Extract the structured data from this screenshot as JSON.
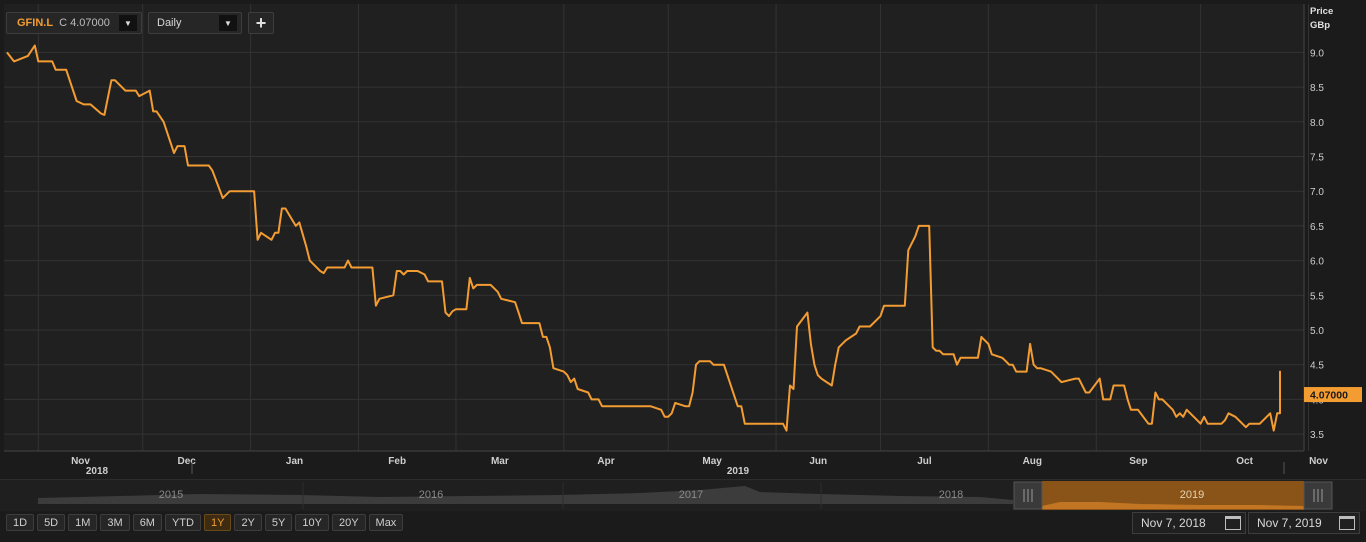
{
  "toolbar": {
    "symbol": "GFIN.L",
    "close_label": "C 4.07000",
    "interval": "Daily",
    "add_label": "+"
  },
  "colors": {
    "series": "#f39c32",
    "background": "#1b1b1b",
    "grid": "#333333"
  },
  "icons": {
    "dropdown": "triangle-down-icon",
    "calendar": "calendar-icon",
    "add": "plus-icon",
    "handle": "grip-icon"
  },
  "navigator": {
    "years": [
      "2015",
      "2016",
      "2017",
      "2018",
      "2019"
    ],
    "selected_year": "2019"
  },
  "range_buttons": [
    "1D",
    "5D",
    "1M",
    "3M",
    "6M",
    "YTD",
    "1Y",
    "2Y",
    "5Y",
    "10Y",
    "20Y",
    "Max"
  ],
  "active_range": "1Y",
  "date_range": {
    "start": "Nov 7, 2018",
    "end": "Nov 7, 2019"
  },
  "chart_data": {
    "type": "line",
    "title": "",
    "ylabel_line1": "Price",
    "ylabel_line2": "GBp",
    "ylim": [
      3.2,
      9.5
    ],
    "yticks": [
      "9.0",
      "8.5",
      "8.0",
      "7.5",
      "7.0",
      "6.5",
      "6.0",
      "5.5",
      "5.0",
      "4.5",
      "4.0",
      "3.5"
    ],
    "last_value_label": "4.07000",
    "last_value": 4.07,
    "months": [
      "Nov",
      "Dec",
      "Jan",
      "Feb",
      "Mar",
      "Apr",
      "May",
      "Jun",
      "Jul",
      "Aug",
      "Sep",
      "Oct",
      "Nov"
    ],
    "years": [
      "2018",
      "2019"
    ],
    "x_start": "2018-11-07",
    "x_end": "2019-11-07",
    "series": [
      {
        "values": [
          [
            "2018-10-23",
            9.0
          ],
          [
            "2018-10-25",
            8.87
          ],
          [
            "2018-10-29",
            8.95
          ],
          [
            "2018-10-31",
            9.1
          ],
          [
            "2018-11-01",
            8.87
          ],
          [
            "2018-11-05",
            8.87
          ],
          [
            "2018-11-06",
            8.75
          ],
          [
            "2018-11-09",
            8.75
          ],
          [
            "2018-11-12",
            8.3
          ],
          [
            "2018-11-14",
            8.25
          ],
          [
            "2018-11-16",
            8.25
          ],
          [
            "2018-11-19",
            8.12
          ],
          [
            "2018-11-20",
            8.1
          ],
          [
            "2018-11-22",
            8.6
          ],
          [
            "2018-11-23",
            8.6
          ],
          [
            "2018-11-26",
            8.45
          ],
          [
            "2018-11-29",
            8.45
          ],
          [
            "2018-11-30",
            8.37
          ],
          [
            "2018-12-03",
            8.45
          ],
          [
            "2018-12-04",
            8.15
          ],
          [
            "2018-12-05",
            8.15
          ],
          [
            "2018-12-07",
            8.0
          ],
          [
            "2018-12-10",
            7.55
          ],
          [
            "2018-12-11",
            7.65
          ],
          [
            "2018-12-13",
            7.65
          ],
          [
            "2018-12-14",
            7.37
          ],
          [
            "2018-12-20",
            7.37
          ],
          [
            "2018-12-21",
            7.3
          ],
          [
            "2018-12-24",
            6.9
          ],
          [
            "2018-12-26",
            7.0
          ],
          [
            "2019-01-02",
            7.0
          ],
          [
            "2019-01-03",
            6.3
          ],
          [
            "2019-01-04",
            6.4
          ],
          [
            "2019-01-07",
            6.3
          ],
          [
            "2019-01-08",
            6.4
          ],
          [
            "2019-01-09",
            6.4
          ],
          [
            "2019-01-10",
            6.75
          ],
          [
            "2019-01-11",
            6.75
          ],
          [
            "2019-01-14",
            6.5
          ],
          [
            "2019-01-15",
            6.55
          ],
          [
            "2019-01-17",
            6.2
          ],
          [
            "2019-01-18",
            6.0
          ],
          [
            "2019-01-21",
            5.85
          ],
          [
            "2019-01-22",
            5.82
          ],
          [
            "2019-01-23",
            5.9
          ],
          [
            "2019-01-28",
            5.9
          ],
          [
            "2019-01-29",
            6.0
          ],
          [
            "2019-01-30",
            5.9
          ],
          [
            "2019-02-05",
            5.9
          ],
          [
            "2019-02-06",
            5.35
          ],
          [
            "2019-02-07",
            5.45
          ],
          [
            "2019-02-11",
            5.5
          ],
          [
            "2019-02-12",
            5.85
          ],
          [
            "2019-02-13",
            5.85
          ],
          [
            "2019-02-14",
            5.8
          ],
          [
            "2019-02-15",
            5.85
          ],
          [
            "2019-02-18",
            5.85
          ],
          [
            "2019-02-20",
            5.8
          ],
          [
            "2019-02-21",
            5.7
          ],
          [
            "2019-02-25",
            5.7
          ],
          [
            "2019-02-26",
            5.25
          ],
          [
            "2019-02-27",
            5.2
          ],
          [
            "2019-02-28",
            5.27
          ],
          [
            "2019-03-01",
            5.3
          ],
          [
            "2019-03-04",
            5.3
          ],
          [
            "2019-03-05",
            5.75
          ],
          [
            "2019-03-06",
            5.6
          ],
          [
            "2019-03-07",
            5.65
          ],
          [
            "2019-03-11",
            5.65
          ],
          [
            "2019-03-13",
            5.55
          ],
          [
            "2019-03-14",
            5.45
          ],
          [
            "2019-03-18",
            5.4
          ],
          [
            "2019-03-19",
            5.25
          ],
          [
            "2019-03-20",
            5.1
          ],
          [
            "2019-03-25",
            5.1
          ],
          [
            "2019-03-26",
            4.9
          ],
          [
            "2019-03-27",
            4.9
          ],
          [
            "2019-03-28",
            4.75
          ],
          [
            "2019-03-29",
            4.45
          ],
          [
            "2019-04-01",
            4.4
          ],
          [
            "2019-04-02",
            4.35
          ],
          [
            "2019-04-03",
            4.25
          ],
          [
            "2019-04-04",
            4.3
          ],
          [
            "2019-04-05",
            4.15
          ],
          [
            "2019-04-08",
            4.1
          ],
          [
            "2019-04-09",
            4.0
          ],
          [
            "2019-04-11",
            4.0
          ],
          [
            "2019-04-12",
            3.9
          ],
          [
            "2019-04-26",
            3.9
          ],
          [
            "2019-04-29",
            3.85
          ],
          [
            "2019-04-30",
            3.75
          ],
          [
            "2019-05-01",
            3.75
          ],
          [
            "2019-05-02",
            3.8
          ],
          [
            "2019-05-03",
            3.95
          ],
          [
            "2019-05-06",
            3.9
          ],
          [
            "2019-05-07",
            3.9
          ],
          [
            "2019-05-08",
            4.1
          ],
          [
            "2019-05-09",
            4.5
          ],
          [
            "2019-05-10",
            4.55
          ],
          [
            "2019-05-13",
            4.55
          ],
          [
            "2019-05-14",
            4.5
          ],
          [
            "2019-05-17",
            4.5
          ],
          [
            "2019-05-20",
            4.05
          ],
          [
            "2019-05-21",
            3.9
          ],
          [
            "2019-05-22",
            3.9
          ],
          [
            "2019-05-23",
            3.65
          ],
          [
            "2019-06-03",
            3.65
          ],
          [
            "2019-06-04",
            3.55
          ],
          [
            "2019-06-05",
            4.2
          ],
          [
            "2019-06-06",
            4.15
          ],
          [
            "2019-06-07",
            5.05
          ],
          [
            "2019-06-10",
            5.25
          ],
          [
            "2019-06-11",
            4.8
          ],
          [
            "2019-06-12",
            4.5
          ],
          [
            "2019-06-13",
            4.35
          ],
          [
            "2019-06-14",
            4.3
          ],
          [
            "2019-06-17",
            4.2
          ],
          [
            "2019-06-18",
            4.5
          ],
          [
            "2019-06-19",
            4.75
          ],
          [
            "2019-06-20",
            4.8
          ],
          [
            "2019-06-21",
            4.85
          ],
          [
            "2019-06-24",
            4.95
          ],
          [
            "2019-06-25",
            5.05
          ],
          [
            "2019-06-28",
            5.05
          ],
          [
            "2019-07-01",
            5.2
          ],
          [
            "2019-07-02",
            5.35
          ],
          [
            "2019-07-08",
            5.35
          ],
          [
            "2019-07-09",
            6.15
          ],
          [
            "2019-07-11",
            6.35
          ],
          [
            "2019-07-12",
            6.5
          ],
          [
            "2019-07-15",
            6.5
          ],
          [
            "2019-07-16",
            4.75
          ],
          [
            "2019-07-17",
            4.7
          ],
          [
            "2019-07-18",
            4.7
          ],
          [
            "2019-07-19",
            4.65
          ],
          [
            "2019-07-22",
            4.65
          ],
          [
            "2019-07-23",
            4.5
          ],
          [
            "2019-07-24",
            4.6
          ],
          [
            "2019-07-29",
            4.6
          ],
          [
            "2019-07-30",
            4.9
          ],
          [
            "2019-07-31",
            4.85
          ],
          [
            "2019-08-01",
            4.8
          ],
          [
            "2019-08-02",
            4.65
          ],
          [
            "2019-08-05",
            4.6
          ],
          [
            "2019-08-06",
            4.55
          ],
          [
            "2019-08-07",
            4.5
          ],
          [
            "2019-08-08",
            4.5
          ],
          [
            "2019-08-09",
            4.4
          ],
          [
            "2019-08-12",
            4.4
          ],
          [
            "2019-08-13",
            4.8
          ],
          [
            "2019-08-14",
            4.5
          ],
          [
            "2019-08-15",
            4.45
          ],
          [
            "2019-08-16",
            4.45
          ],
          [
            "2019-08-19",
            4.4
          ],
          [
            "2019-08-20",
            4.35
          ],
          [
            "2019-08-21",
            4.3
          ],
          [
            "2019-08-22",
            4.25
          ],
          [
            "2019-08-26",
            4.3
          ],
          [
            "2019-08-27",
            4.3
          ],
          [
            "2019-08-29",
            4.1
          ],
          [
            "2019-08-30",
            4.1
          ],
          [
            "2019-09-02",
            4.3
          ],
          [
            "2019-09-03",
            4.0
          ],
          [
            "2019-09-05",
            4.0
          ],
          [
            "2019-09-06",
            4.2
          ],
          [
            "2019-09-09",
            4.2
          ],
          [
            "2019-09-10",
            4.0
          ],
          [
            "2019-09-11",
            3.85
          ],
          [
            "2019-09-13",
            3.85
          ],
          [
            "2019-09-16",
            3.65
          ],
          [
            "2019-09-17",
            3.65
          ],
          [
            "2019-09-18",
            4.1
          ],
          [
            "2019-09-19",
            4.0
          ],
          [
            "2019-09-20",
            4.0
          ],
          [
            "2019-09-23",
            3.85
          ],
          [
            "2019-09-24",
            3.75
          ],
          [
            "2019-09-25",
            3.8
          ],
          [
            "2019-09-26",
            3.75
          ],
          [
            "2019-09-27",
            3.85
          ],
          [
            "2019-09-30",
            3.7
          ],
          [
            "2019-10-01",
            3.65
          ],
          [
            "2019-10-02",
            3.75
          ],
          [
            "2019-10-03",
            3.65
          ],
          [
            "2019-10-07",
            3.65
          ],
          [
            "2019-10-08",
            3.7
          ],
          [
            "2019-10-09",
            3.8
          ],
          [
            "2019-10-11",
            3.75
          ],
          [
            "2019-10-14",
            3.6
          ],
          [
            "2019-10-15",
            3.65
          ],
          [
            "2019-10-18",
            3.65
          ],
          [
            "2019-10-21",
            3.8
          ],
          [
            "2019-10-22",
            3.55
          ],
          [
            "2019-10-23",
            3.8
          ],
          [
            "2019-10-25",
            3.8
          ],
          [
            "2019-10-28",
            4.4
          ],
          [
            "2019-10-30",
            4.4
          ],
          [
            "2019-10-31",
            4.05
          ],
          [
            "2019-11-01",
            4.05
          ],
          [
            "2019-11-04",
            4.1
          ],
          [
            "2019-11-06",
            4.1
          ],
          [
            "2019-11-07",
            4.07
          ]
        ]
      }
    ]
  }
}
